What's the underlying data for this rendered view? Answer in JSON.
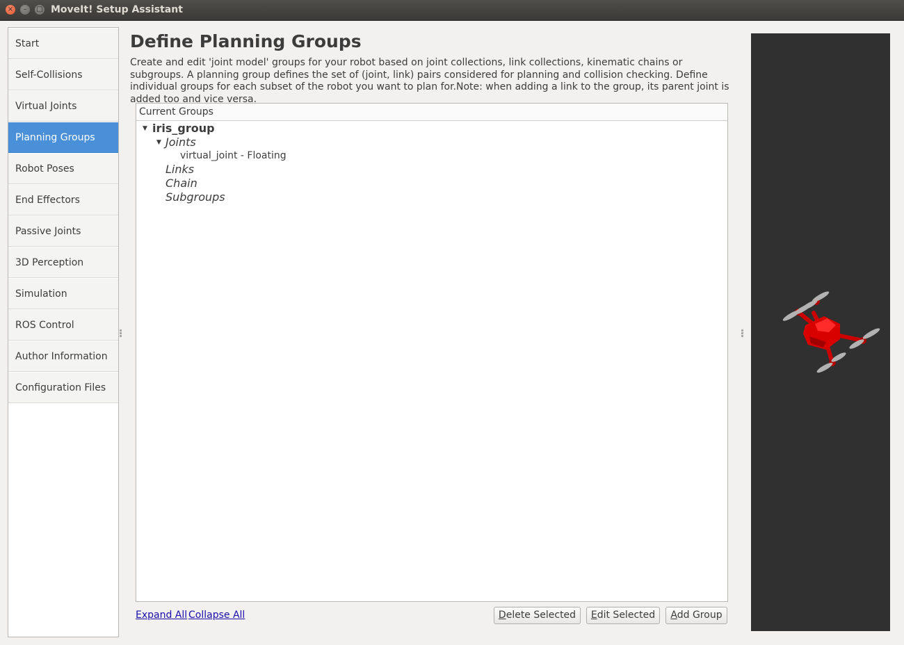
{
  "window": {
    "title": "MoveIt! Setup Assistant"
  },
  "sidebar": {
    "items": [
      {
        "label": "Start"
      },
      {
        "label": "Self-Collisions"
      },
      {
        "label": "Virtual Joints"
      },
      {
        "label": "Planning Groups",
        "selected": true
      },
      {
        "label": "Robot Poses"
      },
      {
        "label": "End Effectors"
      },
      {
        "label": "Passive Joints"
      },
      {
        "label": "3D Perception"
      },
      {
        "label": "Simulation"
      },
      {
        "label": "ROS Control"
      },
      {
        "label": "Author Information"
      },
      {
        "label": "Configuration Files"
      }
    ]
  },
  "main": {
    "heading": "Define Planning Groups",
    "description": "Create and edit 'joint model' groups for your robot based on joint collections, link collections, kinematic chains or subgroups. A planning group defines the set of (joint, link) pairs considered for planning and collision checking. Define individual groups for each subset of the robot you want to plan for.Note: when adding a link to the group, its parent joint is added too and vice versa.",
    "tree": {
      "header": "Current Groups",
      "group": "iris_group",
      "joints_label": "Joints",
      "joint_item": "virtual_joint - Floating",
      "links_label": "Links",
      "chain_label": "Chain",
      "subgroups_label": "Subgroups"
    },
    "links": {
      "expand_all": "Expand All",
      "collapse_all": "Collapse All"
    },
    "buttons": {
      "delete_first": "D",
      "delete_rest": "elete Selected",
      "edit_first": "E",
      "edit_rest": "dit Selected",
      "add_first": "A",
      "add_rest": "dd Group"
    }
  },
  "colors": {
    "accent": "#4a90d9",
    "robot": "#d90000",
    "viewport_bg": "#303030"
  },
  "icons": {
    "close": "close-icon",
    "minimize": "minimize-icon",
    "maximize": "maximize-icon",
    "expand": "triangle-down-icon"
  }
}
